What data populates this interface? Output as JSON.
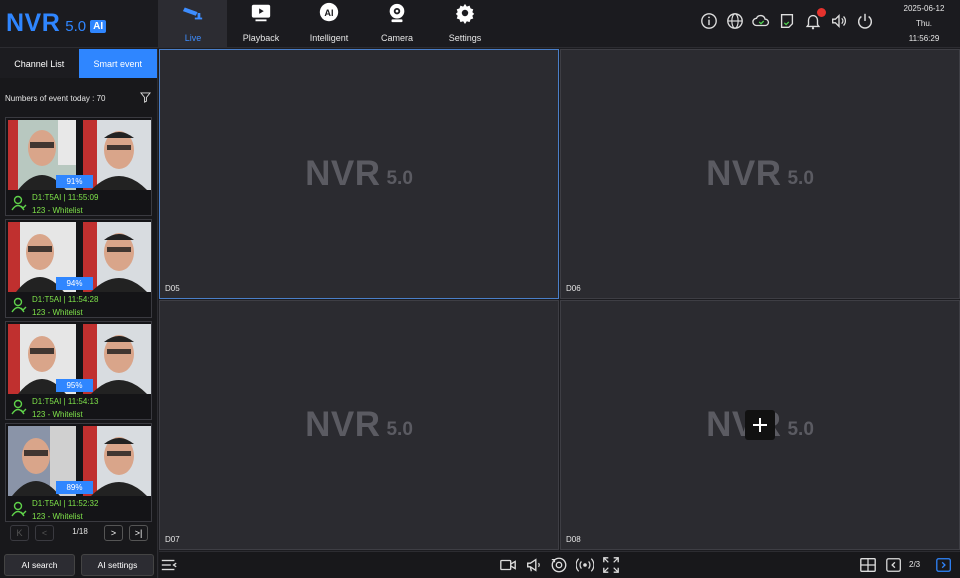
{
  "logo": {
    "brand": "NVR",
    "version": "5.0",
    "badge": "AI"
  },
  "nav": [
    {
      "label": "Live",
      "icon": "camera-live-icon",
      "active": true
    },
    {
      "label": "Playback",
      "icon": "playback-icon"
    },
    {
      "label": "Intelligent",
      "icon": "ai-icon"
    },
    {
      "label": "Camera",
      "icon": "webcam-icon"
    },
    {
      "label": "Settings",
      "icon": "gear-icon"
    }
  ],
  "topicons": [
    "info-icon",
    "globe-icon",
    "cloud-icon",
    "message-icon",
    "alarm-bell-icon",
    "volume-icon",
    "power-icon"
  ],
  "datetime": {
    "date": "2025-06-12",
    "day": "Thu.",
    "time": "11:56:29"
  },
  "sidebar": {
    "tabs": [
      {
        "label": "Channel List"
      },
      {
        "label": "Smart event",
        "active": true
      }
    ],
    "event_count": "Numbers of event today : 70",
    "events": [
      {
        "percent": "91%",
        "line1": "D1:T5AI | 11:55:09",
        "line2": "123 - Whitelist"
      },
      {
        "percent": "94%",
        "line1": "D1:T5AI | 11:54:28",
        "line2": "123 - Whitelist"
      },
      {
        "percent": "95%",
        "line1": "D1:T5AI | 11:54:13",
        "line2": "123 - Whitelist"
      },
      {
        "percent": "89%",
        "line1": "D1:T5AI | 11:52:32",
        "line2": "123 - Whitelist"
      }
    ],
    "pager": {
      "text": "1/18"
    },
    "ai_search": "AI search",
    "ai_settings": "AI settings"
  },
  "cells": [
    {
      "label": "D05",
      "wm_main": "NVR",
      "wm_ver": "5.0"
    },
    {
      "label": "D06",
      "wm_main": "NVR",
      "wm_ver": "5.0"
    },
    {
      "label": "D07",
      "wm_main": "NVR",
      "wm_ver": "5.0"
    },
    {
      "label": "D08",
      "wm_main": "NVR",
      "wm_ver": "5.0"
    }
  ],
  "bottombar": {
    "icons": [
      "menu-collapse-icon",
      "record-icon",
      "talk-icon",
      "ptz-icon",
      "broadcast-icon",
      "fullscreen-icon",
      "layout-icon"
    ],
    "page": "2/3"
  },
  "colors": {
    "accent": "#2f86ff",
    "event_text": "#7fe34a",
    "background": "#1c1c20",
    "alarm": "#e5322d"
  }
}
